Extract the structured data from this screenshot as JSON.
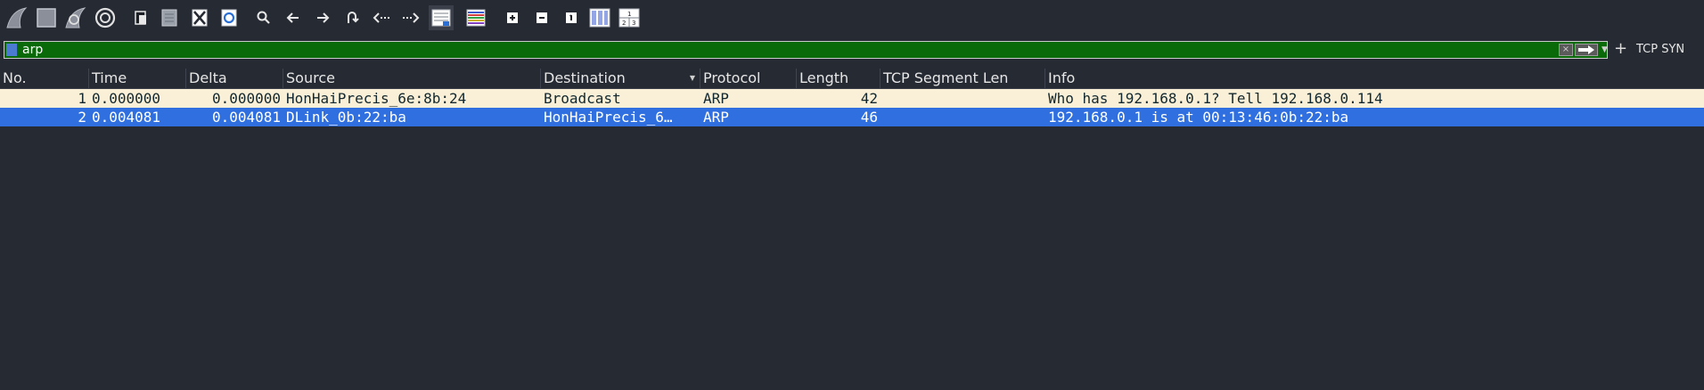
{
  "toolbar": {
    "buttons": [
      {
        "name": "start-capture-button",
        "icon": "shark-fin-icon"
      },
      {
        "name": "stop-capture-button",
        "icon": "stop-square-icon"
      },
      {
        "name": "restart-capture-button",
        "icon": "shark-restart-icon"
      },
      {
        "name": "capture-options-button",
        "icon": "gear-icon"
      },
      {
        "name": "open-file-button",
        "icon": "open-file-icon"
      },
      {
        "name": "save-file-button",
        "icon": "save-file-icon"
      },
      {
        "name": "close-file-button",
        "icon": "close-file-icon"
      },
      {
        "name": "reload-file-button",
        "icon": "reload-icon"
      },
      {
        "name": "find-packet-button",
        "icon": "search-icon"
      },
      {
        "name": "go-back-button",
        "icon": "arrow-left-icon"
      },
      {
        "name": "go-forward-button",
        "icon": "arrow-right-icon"
      },
      {
        "name": "go-to-packet-button",
        "icon": "jump-icon"
      },
      {
        "name": "go-first-packet-button",
        "icon": "first-packet-icon"
      },
      {
        "name": "go-last-packet-button",
        "icon": "last-packet-icon"
      },
      {
        "name": "autoscroll-button",
        "icon": "autoscroll-icon"
      },
      {
        "name": "colorize-button",
        "icon": "colorize-icon"
      },
      {
        "name": "zoom-in-button",
        "icon": "zoom-in-icon"
      },
      {
        "name": "zoom-out-button",
        "icon": "zoom-out-icon"
      },
      {
        "name": "normal-size-button",
        "icon": "normal-size-icon"
      },
      {
        "name": "resize-columns-button",
        "icon": "resize-columns-icon"
      },
      {
        "name": "resize-columns-2-button",
        "icon": "columns-numbered-icon"
      }
    ]
  },
  "filter": {
    "value": "arp",
    "clear_icon": "×",
    "plus_label": "+",
    "saved_filter_label": "TCP SYN"
  },
  "columns": [
    "No.",
    "Time",
    "Delta",
    "Source",
    "Destination",
    "Protocol",
    "Length",
    "TCP Segment Len",
    "Info"
  ],
  "sorted_column": "Destination",
  "packets": [
    {
      "no": "1",
      "time": "0.000000",
      "delta": "0.000000",
      "source": "HonHaiPrecis_6e:8b:24",
      "destination": "Broadcast",
      "protocol": "ARP",
      "length": "42",
      "tcp_seg_len": "",
      "info": "Who has 192.168.0.1? Tell 192.168.0.114",
      "selected": false
    },
    {
      "no": "2",
      "time": "0.004081",
      "delta": "0.004081",
      "source": "DLink_0b:22:ba",
      "destination": "HonHaiPrecis_6…",
      "protocol": "ARP",
      "length": "46",
      "tcp_seg_len": "",
      "info": "192.168.0.1 is at 00:13:46:0b:22:ba",
      "selected": true
    }
  ],
  "colors": {
    "background": "#262a33",
    "filter_valid": "#0a6a0a",
    "row_arp_bg": "#faf0d7",
    "row_arp_fg": "#12272e",
    "row_selected_bg": "#2f6fe0",
    "row_selected_fg": "#ffffff"
  }
}
